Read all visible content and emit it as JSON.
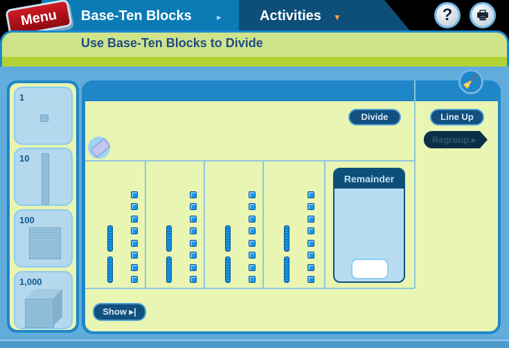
{
  "header": {
    "menu_label": "Menu",
    "tabs": [
      {
        "label": "Base-Ten Blocks",
        "arrow": "▸"
      },
      {
        "label": "Activities",
        "arrow": "▼"
      }
    ],
    "help_label": "?",
    "print_icon": "printer-icon",
    "accent_color": "#f4a340"
  },
  "title": "Use Base-Ten Blocks to Divide",
  "palette": {
    "items": [
      {
        "label": "1",
        "icon": "unit-block-icon"
      },
      {
        "label": "10",
        "icon": "rod-block-icon"
      },
      {
        "label": "100",
        "icon": "flat-block-icon"
      },
      {
        "label": "1,000",
        "icon": "cube-block-icon"
      }
    ]
  },
  "workspace": {
    "divide_label": "Divide",
    "line_up_label": "Line Up",
    "regroup_label": "Regroup ▸",
    "show_label": "Show ▸|",
    "remainder_label": "Remainder",
    "remainder_value": "",
    "groups": [
      {
        "tens": 2,
        "ones": 8
      },
      {
        "tens": 2,
        "ones": 8
      },
      {
        "tens": 2,
        "ones": 8
      },
      {
        "tens": 2,
        "ones": 8
      }
    ]
  }
}
